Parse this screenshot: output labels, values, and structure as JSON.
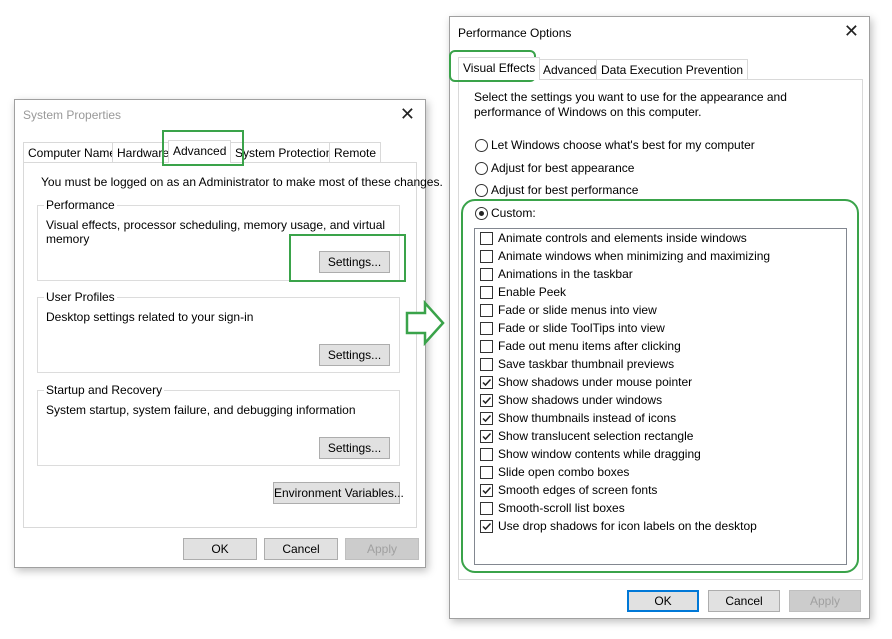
{
  "colors": {
    "highlight": "#3aa34a",
    "accent": "#0078d7"
  },
  "system_properties": {
    "title": "System Properties",
    "tabs": [
      {
        "label": "Computer Name",
        "active": false
      },
      {
        "label": "Hardware",
        "active": false
      },
      {
        "label": "Advanced",
        "active": true
      },
      {
        "label": "System Protection",
        "active": false
      },
      {
        "label": "Remote",
        "active": false
      }
    ],
    "admin_note": "You must be logged on as an Administrator to make most of these changes.",
    "performance": {
      "title": "Performance",
      "description": "Visual effects, processor scheduling, memory usage, and virtual memory",
      "settings_button": "Settings..."
    },
    "user_profiles": {
      "title": "User Profiles",
      "description": "Desktop settings related to your sign-in",
      "settings_button": "Settings..."
    },
    "startup_recovery": {
      "title": "Startup and Recovery",
      "description": "System startup, system failure, and debugging information",
      "settings_button": "Settings..."
    },
    "env_button": "Environment Variables...",
    "ok": "OK",
    "cancel": "Cancel",
    "apply": "Apply"
  },
  "performance_options": {
    "title": "Performance Options",
    "tabs": [
      {
        "label": "Visual Effects",
        "active": true
      },
      {
        "label": "Advanced",
        "active": false
      },
      {
        "label": "Data Execution Prevention",
        "active": false
      }
    ],
    "intro": [
      "Select the settings you want to use for the appearance and",
      "performance of Windows on this computer."
    ],
    "radios": [
      {
        "label": "Let Windows choose what's best for my computer",
        "selected": false
      },
      {
        "label": "Adjust for best appearance",
        "selected": false
      },
      {
        "label": "Adjust for best performance",
        "selected": false
      },
      {
        "label": "Custom:",
        "selected": true
      }
    ],
    "effects": [
      {
        "label": "Animate controls and elements inside windows",
        "checked": false
      },
      {
        "label": "Animate windows when minimizing and maximizing",
        "checked": false
      },
      {
        "label": "Animations in the taskbar",
        "checked": false
      },
      {
        "label": "Enable Peek",
        "checked": false
      },
      {
        "label": "Fade or slide menus into view",
        "checked": false
      },
      {
        "label": "Fade or slide ToolTips into view",
        "checked": false
      },
      {
        "label": "Fade out menu items after clicking",
        "checked": false
      },
      {
        "label": "Save taskbar thumbnail previews",
        "checked": false
      },
      {
        "label": "Show shadows under mouse pointer",
        "checked": true
      },
      {
        "label": "Show shadows under windows",
        "checked": true
      },
      {
        "label": "Show thumbnails instead of icons",
        "checked": true
      },
      {
        "label": "Show translucent selection rectangle",
        "checked": true
      },
      {
        "label": "Show window contents while dragging",
        "checked": false
      },
      {
        "label": "Slide open combo boxes",
        "checked": false
      },
      {
        "label": "Smooth edges of screen fonts",
        "checked": true
      },
      {
        "label": "Smooth-scroll list boxes",
        "checked": false
      },
      {
        "label": "Use drop shadows for icon labels on the desktop",
        "checked": true
      }
    ],
    "ok": "OK",
    "cancel": "Cancel",
    "apply": "Apply"
  }
}
